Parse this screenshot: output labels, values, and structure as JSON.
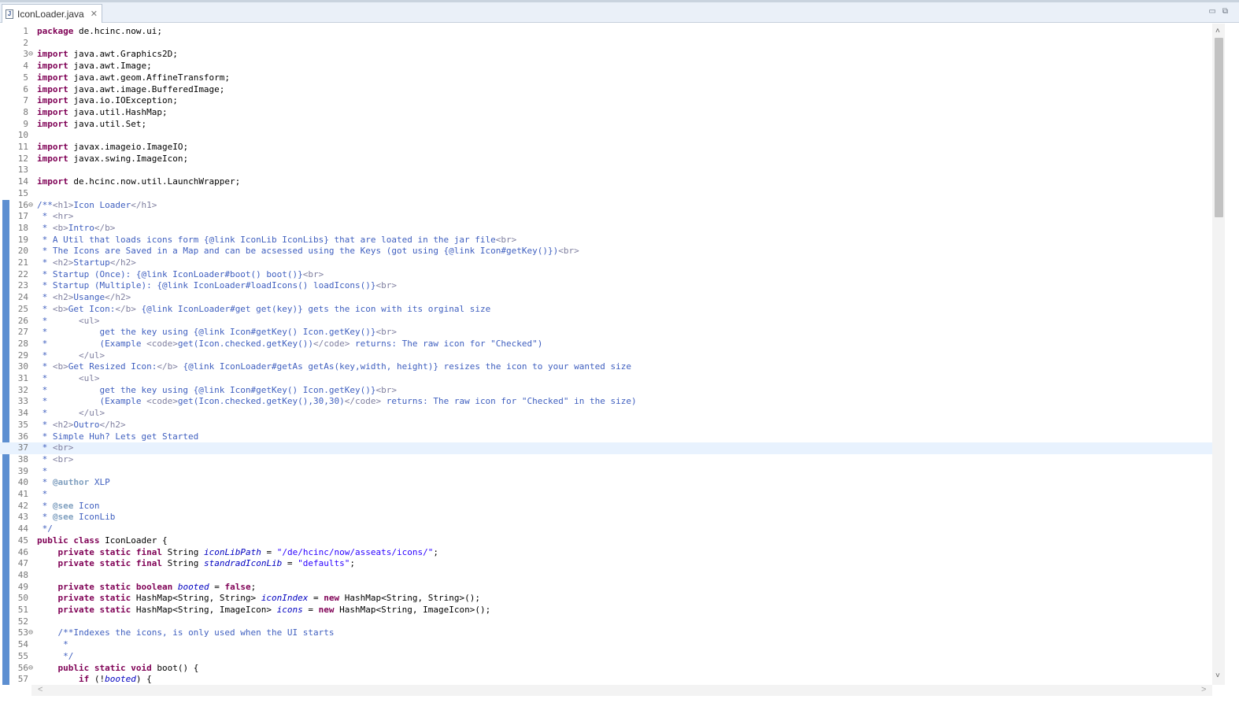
{
  "tab": {
    "title": "IconLoader.java",
    "file_icon_glyph": "J"
  },
  "cursor_line": 37,
  "lines": [
    {
      "n": "1",
      "f": "",
      "s": [
        {
          "c": "kw",
          "t": "package"
        },
        {
          "t": " de.hcinc.now.ui;"
        }
      ]
    },
    {
      "n": "2",
      "f": "",
      "s": []
    },
    {
      "n": "3",
      "f": "⊖",
      "s": [
        {
          "c": "kw",
          "t": "import"
        },
        {
          "t": " java.awt.Graphics2D;"
        }
      ]
    },
    {
      "n": "4",
      "f": "",
      "s": [
        {
          "c": "kw",
          "t": "import"
        },
        {
          "t": " java.awt.Image;"
        }
      ]
    },
    {
      "n": "5",
      "f": "",
      "s": [
        {
          "c": "kw",
          "t": "import"
        },
        {
          "t": " java.awt.geom.AffineTransform;"
        }
      ]
    },
    {
      "n": "6",
      "f": "",
      "s": [
        {
          "c": "kw",
          "t": "import"
        },
        {
          "t": " java.awt.image.BufferedImage;"
        }
      ]
    },
    {
      "n": "7",
      "f": "",
      "s": [
        {
          "c": "kw",
          "t": "import"
        },
        {
          "t": " java.io.IOException;"
        }
      ]
    },
    {
      "n": "8",
      "f": "",
      "s": [
        {
          "c": "kw",
          "t": "import"
        },
        {
          "t": " java.util.HashMap;"
        }
      ]
    },
    {
      "n": "9",
      "f": "",
      "s": [
        {
          "c": "kw",
          "t": "import"
        },
        {
          "t": " java.util.Set;"
        }
      ]
    },
    {
      "n": "10",
      "f": "",
      "s": []
    },
    {
      "n": "11",
      "f": "",
      "s": [
        {
          "c": "kw",
          "t": "import"
        },
        {
          "t": " javax.imageio.ImageIO;"
        }
      ]
    },
    {
      "n": "12",
      "f": "",
      "s": [
        {
          "c": "kw",
          "t": "import"
        },
        {
          "t": " javax.swing.ImageIcon;"
        }
      ]
    },
    {
      "n": "13",
      "f": "",
      "s": []
    },
    {
      "n": "14",
      "f": "",
      "s": [
        {
          "c": "kw",
          "t": "import"
        },
        {
          "t": " de.hcinc.now.util.LaunchWrapper;"
        }
      ]
    },
    {
      "n": "15",
      "f": "",
      "s": []
    },
    {
      "n": "16",
      "f": "⊖",
      "s": [
        {
          "c": "doc",
          "t": "/**"
        },
        {
          "c": "tag",
          "t": "<h1>"
        },
        {
          "c": "doc",
          "t": "Icon Loader"
        },
        {
          "c": "tag",
          "t": "</h1>"
        }
      ]
    },
    {
      "n": "17",
      "f": "",
      "s": [
        {
          "c": "doc",
          "t": " * "
        },
        {
          "c": "tag",
          "t": "<hr>"
        }
      ]
    },
    {
      "n": "18",
      "f": "",
      "s": [
        {
          "c": "doc",
          "t": " * "
        },
        {
          "c": "tag",
          "t": "<b>"
        },
        {
          "c": "doc",
          "t": "Intro"
        },
        {
          "c": "tag",
          "t": "</b>"
        }
      ]
    },
    {
      "n": "19",
      "f": "",
      "s": [
        {
          "c": "doc",
          "t": " * A Util that loads icons form {@link IconLib IconLibs} that are loated in the jar file"
        },
        {
          "c": "tag",
          "t": "<br>"
        }
      ]
    },
    {
      "n": "20",
      "f": "",
      "s": [
        {
          "c": "doc",
          "t": " * The Icons are Saved in a Map and can be acsessed using the Keys (got using {@link Icon#getKey()})"
        },
        {
          "c": "tag",
          "t": "<br>"
        }
      ]
    },
    {
      "n": "21",
      "f": "",
      "s": [
        {
          "c": "doc",
          "t": " * "
        },
        {
          "c": "tag",
          "t": "<h2>"
        },
        {
          "c": "doc",
          "t": "Startup"
        },
        {
          "c": "tag",
          "t": "</h2>"
        }
      ]
    },
    {
      "n": "22",
      "f": "",
      "s": [
        {
          "c": "doc",
          "t": " * Startup (Once): {@link IconLoader#boot() boot()}"
        },
        {
          "c": "tag",
          "t": "<br>"
        }
      ]
    },
    {
      "n": "23",
      "f": "",
      "s": [
        {
          "c": "doc",
          "t": " * Startup (Multiple): {@link IconLoader#loadIcons() loadIcons()}"
        },
        {
          "c": "tag",
          "t": "<br>"
        }
      ]
    },
    {
      "n": "24",
      "f": "",
      "s": [
        {
          "c": "doc",
          "t": " * "
        },
        {
          "c": "tag",
          "t": "<h2>"
        },
        {
          "c": "doc",
          "t": "Usange"
        },
        {
          "c": "tag",
          "t": "</h2>"
        }
      ]
    },
    {
      "n": "25",
      "f": "",
      "s": [
        {
          "c": "doc",
          "t": " * "
        },
        {
          "c": "tag",
          "t": "<b>"
        },
        {
          "c": "doc",
          "t": "Get Icon:"
        },
        {
          "c": "tag",
          "t": "</b>"
        },
        {
          "c": "doc",
          "t": " {@link IconLoader#get get(key)} gets the icon with its orginal size"
        }
      ]
    },
    {
      "n": "26",
      "f": "",
      "s": [
        {
          "c": "doc",
          "t": " *      "
        },
        {
          "c": "tag",
          "t": "<ul>"
        }
      ]
    },
    {
      "n": "27",
      "f": "",
      "s": [
        {
          "c": "doc",
          "t": " *          get the key using {@link Icon#getKey() Icon.getKey()}"
        },
        {
          "c": "tag",
          "t": "<br>"
        }
      ]
    },
    {
      "n": "28",
      "f": "",
      "s": [
        {
          "c": "doc",
          "t": " *          (Example "
        },
        {
          "c": "tag",
          "t": "<code>"
        },
        {
          "c": "doc",
          "t": "get(Icon.checked.getKey())"
        },
        {
          "c": "tag",
          "t": "</code>"
        },
        {
          "c": "doc",
          "t": " returns: The raw icon for \"Checked\")"
        }
      ]
    },
    {
      "n": "29",
      "f": "",
      "s": [
        {
          "c": "doc",
          "t": " *      "
        },
        {
          "c": "tag",
          "t": "</ul>"
        }
      ]
    },
    {
      "n": "30",
      "f": "",
      "s": [
        {
          "c": "doc",
          "t": " * "
        },
        {
          "c": "tag",
          "t": "<b>"
        },
        {
          "c": "doc",
          "t": "Get Resized Icon:"
        },
        {
          "c": "tag",
          "t": "</b>"
        },
        {
          "c": "doc",
          "t": " {@link IconLoader#getAs getAs(key,width, height)} resizes the icon to your wanted size"
        }
      ]
    },
    {
      "n": "31",
      "f": "",
      "s": [
        {
          "c": "doc",
          "t": " *      "
        },
        {
          "c": "tag",
          "t": "<ul>"
        }
      ]
    },
    {
      "n": "32",
      "f": "",
      "s": [
        {
          "c": "doc",
          "t": " *          get the key using {@link Icon#getKey() Icon.getKey()}"
        },
        {
          "c": "tag",
          "t": "<br>"
        }
      ]
    },
    {
      "n": "33",
      "f": "",
      "s": [
        {
          "c": "doc",
          "t": " *          (Example "
        },
        {
          "c": "tag",
          "t": "<code>"
        },
        {
          "c": "doc",
          "t": "get(Icon.checked.getKey(),30,30)"
        },
        {
          "c": "tag",
          "t": "</code>"
        },
        {
          "c": "doc",
          "t": " returns: The raw icon for \"Checked\" in the size)"
        }
      ]
    },
    {
      "n": "34",
      "f": "",
      "s": [
        {
          "c": "doc",
          "t": " *      "
        },
        {
          "c": "tag",
          "t": "</ul>"
        }
      ]
    },
    {
      "n": "35",
      "f": "",
      "s": [
        {
          "c": "doc",
          "t": " * "
        },
        {
          "c": "tag",
          "t": "<h2>"
        },
        {
          "c": "doc",
          "t": "Outro"
        },
        {
          "c": "tag",
          "t": "</h2>"
        }
      ]
    },
    {
      "n": "36",
      "f": "",
      "s": [
        {
          "c": "doc",
          "t": " * Simple Huh? Lets get Started"
        }
      ]
    },
    {
      "n": "37",
      "f": "",
      "s": [
        {
          "c": "doc",
          "t": " * "
        },
        {
          "c": "tag",
          "t": "<br>"
        }
      ]
    },
    {
      "n": "38",
      "f": "",
      "s": [
        {
          "c": "doc",
          "t": " * "
        },
        {
          "c": "tag",
          "t": "<br>"
        }
      ]
    },
    {
      "n": "39",
      "f": "",
      "s": [
        {
          "c": "doc",
          "t": " *"
        }
      ]
    },
    {
      "n": "40",
      "f": "",
      "s": [
        {
          "c": "doc",
          "t": " * "
        },
        {
          "c": "jk",
          "t": "@author"
        },
        {
          "c": "doc",
          "t": " XLP"
        }
      ]
    },
    {
      "n": "41",
      "f": "",
      "s": [
        {
          "c": "doc",
          "t": " *"
        }
      ]
    },
    {
      "n": "42",
      "f": "",
      "s": [
        {
          "c": "doc",
          "t": " * "
        },
        {
          "c": "jk",
          "t": "@see"
        },
        {
          "c": "doc",
          "t": " Icon"
        }
      ]
    },
    {
      "n": "43",
      "f": "",
      "s": [
        {
          "c": "doc",
          "t": " * "
        },
        {
          "c": "jk",
          "t": "@see"
        },
        {
          "c": "doc",
          "t": " IconLib"
        }
      ]
    },
    {
      "n": "44",
      "f": "",
      "s": [
        {
          "c": "doc",
          "t": " */"
        }
      ]
    },
    {
      "n": "45",
      "f": "",
      "s": [
        {
          "c": "kw",
          "t": "public"
        },
        {
          "t": " "
        },
        {
          "c": "kw",
          "t": "class"
        },
        {
          "t": " IconLoader {"
        }
      ]
    },
    {
      "n": "46",
      "f": "",
      "s": [
        {
          "t": "    "
        },
        {
          "c": "kw",
          "t": "private"
        },
        {
          "t": " "
        },
        {
          "c": "kw",
          "t": "static"
        },
        {
          "t": " "
        },
        {
          "c": "kw",
          "t": "final"
        },
        {
          "t": " String "
        },
        {
          "c": "fld",
          "t": "iconLibPath"
        },
        {
          "t": " = "
        },
        {
          "c": "str",
          "t": "\"/de/hcinc/now/asseats/icons/\""
        },
        {
          "t": ";"
        }
      ]
    },
    {
      "n": "47",
      "f": "",
      "s": [
        {
          "t": "    "
        },
        {
          "c": "kw",
          "t": "private"
        },
        {
          "t": " "
        },
        {
          "c": "kw",
          "t": "static"
        },
        {
          "t": " "
        },
        {
          "c": "kw",
          "t": "final"
        },
        {
          "t": " String "
        },
        {
          "c": "fld",
          "t": "standradIconLib"
        },
        {
          "t": " = "
        },
        {
          "c": "str",
          "t": "\"defaults\""
        },
        {
          "t": ";"
        }
      ]
    },
    {
      "n": "48",
      "f": "",
      "s": []
    },
    {
      "n": "49",
      "f": "",
      "s": [
        {
          "t": "    "
        },
        {
          "c": "kw",
          "t": "private"
        },
        {
          "t": " "
        },
        {
          "c": "kw",
          "t": "static"
        },
        {
          "t": " "
        },
        {
          "c": "kw",
          "t": "boolean"
        },
        {
          "t": " "
        },
        {
          "c": "fld",
          "t": "booted"
        },
        {
          "t": " = "
        },
        {
          "c": "kw",
          "t": "false"
        },
        {
          "t": ";"
        }
      ]
    },
    {
      "n": "50",
      "f": "",
      "s": [
        {
          "t": "    "
        },
        {
          "c": "kw",
          "t": "private"
        },
        {
          "t": " "
        },
        {
          "c": "kw",
          "t": "static"
        },
        {
          "t": " HashMap<String, String> "
        },
        {
          "c": "fld",
          "t": "iconIndex"
        },
        {
          "t": " = "
        },
        {
          "c": "kw",
          "t": "new"
        },
        {
          "t": " HashMap<String, String>();"
        }
      ]
    },
    {
      "n": "51",
      "f": "",
      "s": [
        {
          "t": "    "
        },
        {
          "c": "kw",
          "t": "private"
        },
        {
          "t": " "
        },
        {
          "c": "kw",
          "t": "static"
        },
        {
          "t": " HashMap<String, ImageIcon> "
        },
        {
          "c": "fld",
          "t": "icons"
        },
        {
          "t": " = "
        },
        {
          "c": "kw",
          "t": "new"
        },
        {
          "t": " HashMap<String, ImageIcon>();"
        }
      ]
    },
    {
      "n": "52",
      "f": "",
      "s": []
    },
    {
      "n": "53",
      "f": "⊖",
      "s": [
        {
          "t": "    "
        },
        {
          "c": "doc",
          "t": "/**Indexes the icons, is only used when the UI starts"
        }
      ]
    },
    {
      "n": "54",
      "f": "",
      "s": [
        {
          "c": "doc",
          "t": "     *"
        }
      ]
    },
    {
      "n": "55",
      "f": "",
      "s": [
        {
          "c": "doc",
          "t": "     */"
        }
      ]
    },
    {
      "n": "56",
      "f": "⊖",
      "s": [
        {
          "t": "    "
        },
        {
          "c": "kw",
          "t": "public"
        },
        {
          "t": " "
        },
        {
          "c": "kw",
          "t": "static"
        },
        {
          "t": " "
        },
        {
          "c": "kw",
          "t": "void"
        },
        {
          "t": " boot() {"
        }
      ]
    },
    {
      "n": "57",
      "f": "",
      "s": [
        {
          "t": "        "
        },
        {
          "c": "kw",
          "t": "if"
        },
        {
          "t": " (!"
        },
        {
          "c": "fld",
          "t": "booted"
        },
        {
          "t": ") {"
        }
      ]
    }
  ],
  "scrollbar": {
    "up_arrow": "˄",
    "down_arrow": "˅",
    "left_arrow": "<",
    "right_arrow": ">"
  },
  "window_controls": {
    "minimize": "▭",
    "maximize": "⧉"
  }
}
